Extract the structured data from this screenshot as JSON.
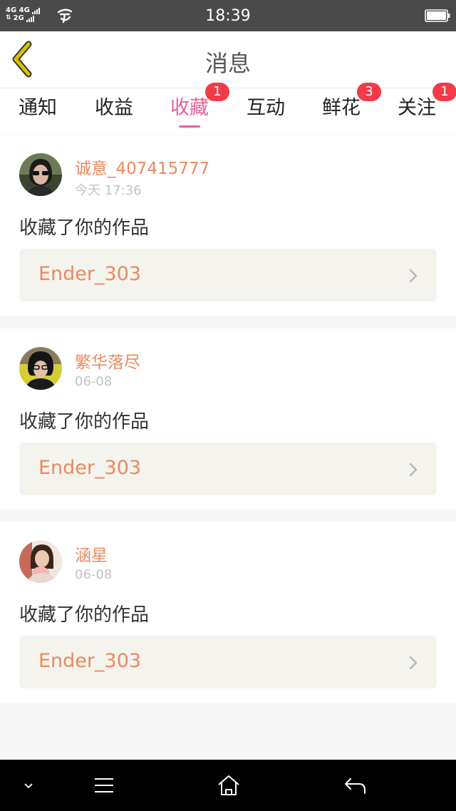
{
  "status_bar": {
    "network_top": "4G 4G",
    "network_bottom": "2G",
    "time": "18:39",
    "icons": [
      "signal-icon",
      "carrier-icon",
      "battery-icon"
    ]
  },
  "header": {
    "title": "消息",
    "back_icon": "chevron-left-icon"
  },
  "tabs": [
    {
      "label": "通知",
      "badge": "",
      "active": false
    },
    {
      "label": "收益",
      "badge": "",
      "active": false
    },
    {
      "label": "收藏",
      "badge": "1",
      "active": true
    },
    {
      "label": "互动",
      "badge": "",
      "active": false
    },
    {
      "label": "鲜花",
      "badge": "3",
      "active": false
    },
    {
      "label": "关注",
      "badge": "1",
      "active": false
    }
  ],
  "messages": [
    {
      "username": "诚意_407415777",
      "time": "今天 17:36",
      "action": "收藏了你的作品",
      "work": "Ender_303"
    },
    {
      "username": "繁华落尽",
      "time": "06-08",
      "action": "收藏了你的作品",
      "work": "Ender_303"
    },
    {
      "username": "涵星",
      "time": "06-08",
      "action": "收藏了你的作品",
      "work": "Ender_303"
    }
  ],
  "nav_bar": {
    "icons": [
      "chevron-down-icon",
      "menu-icon",
      "home-icon",
      "back-arrow-icon"
    ]
  },
  "colors": {
    "accent_pink": "#e7609b",
    "username_orange": "#ea8a5d",
    "badge_red": "#f23b48",
    "back_yellow": "#d9c300"
  }
}
